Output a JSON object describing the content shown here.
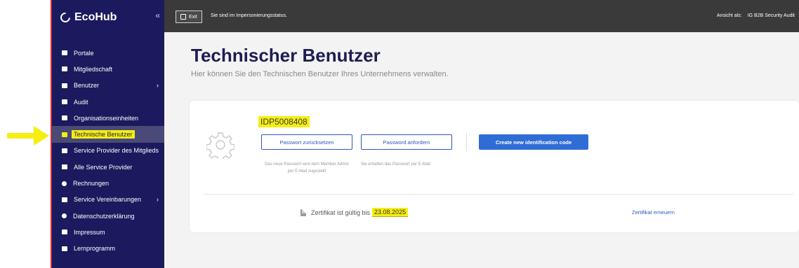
{
  "app": {
    "name": "EcoHub",
    "collapse_glyph": "«"
  },
  "colors": {
    "sidebar": "#1b1a5e",
    "topbar": "#3a3a3a",
    "accent": "#2f6dd6",
    "highlight": "#f5ee12",
    "annotation_red": "#d9262b"
  },
  "sidebar": {
    "items": [
      {
        "label": "Portale",
        "icon": "portal-icon"
      },
      {
        "label": "Mitgliedschaft",
        "icon": "membership-icon"
      },
      {
        "label": "Benutzer",
        "icon": "user-icon",
        "chevron": "›"
      },
      {
        "label": "Audit",
        "icon": "audit-icon"
      },
      {
        "label": "Organisationseinheiten",
        "icon": "org-units-icon"
      },
      {
        "label": "Technische Benutzer",
        "icon": "technical-user-icon",
        "active": true
      },
      {
        "label": "Service Provider des Mitglieds",
        "icon": "service-provider-icon"
      },
      {
        "label": "Alle Service Provider",
        "icon": "all-providers-icon"
      },
      {
        "label": "Rechnungen",
        "icon": "invoice-icon"
      },
      {
        "label": "Service Vereinbarungen",
        "icon": "agreement-icon",
        "chevron": "›"
      },
      {
        "label": "Datenschutzerklärung",
        "icon": "shield-icon"
      },
      {
        "label": "Impressum",
        "icon": "imprint-icon"
      },
      {
        "label": "Lernprogramm",
        "icon": "tutorial-icon"
      }
    ]
  },
  "topbar": {
    "exit_label": "Exit",
    "impersonation_text": "Sie sind im Impersonierungsstatus.",
    "view_as_label": "Ansicht als:",
    "view_as_value": "IG B2B Security Audit"
  },
  "page": {
    "title": "Technischer Benutzer",
    "subtitle": "Hier können Sie den Technischen Benutzer Ihres Unternehmens verwalten."
  },
  "card": {
    "identifier": "IDP5008408",
    "reset_button": "Passwort zurücksetzen",
    "request_button": "Password anfordern",
    "create_button": "Create new identification code",
    "reset_hint": "Das neue Passwort wird dem Member Admin per E-Mail zugestellt",
    "request_hint": "Sie erhalten das Passwort per E-Mail",
    "cert_text": "Zertifikat ist gültig bis",
    "cert_date": "23.08.2025",
    "renew_link": "Zertifikat erneuern"
  }
}
